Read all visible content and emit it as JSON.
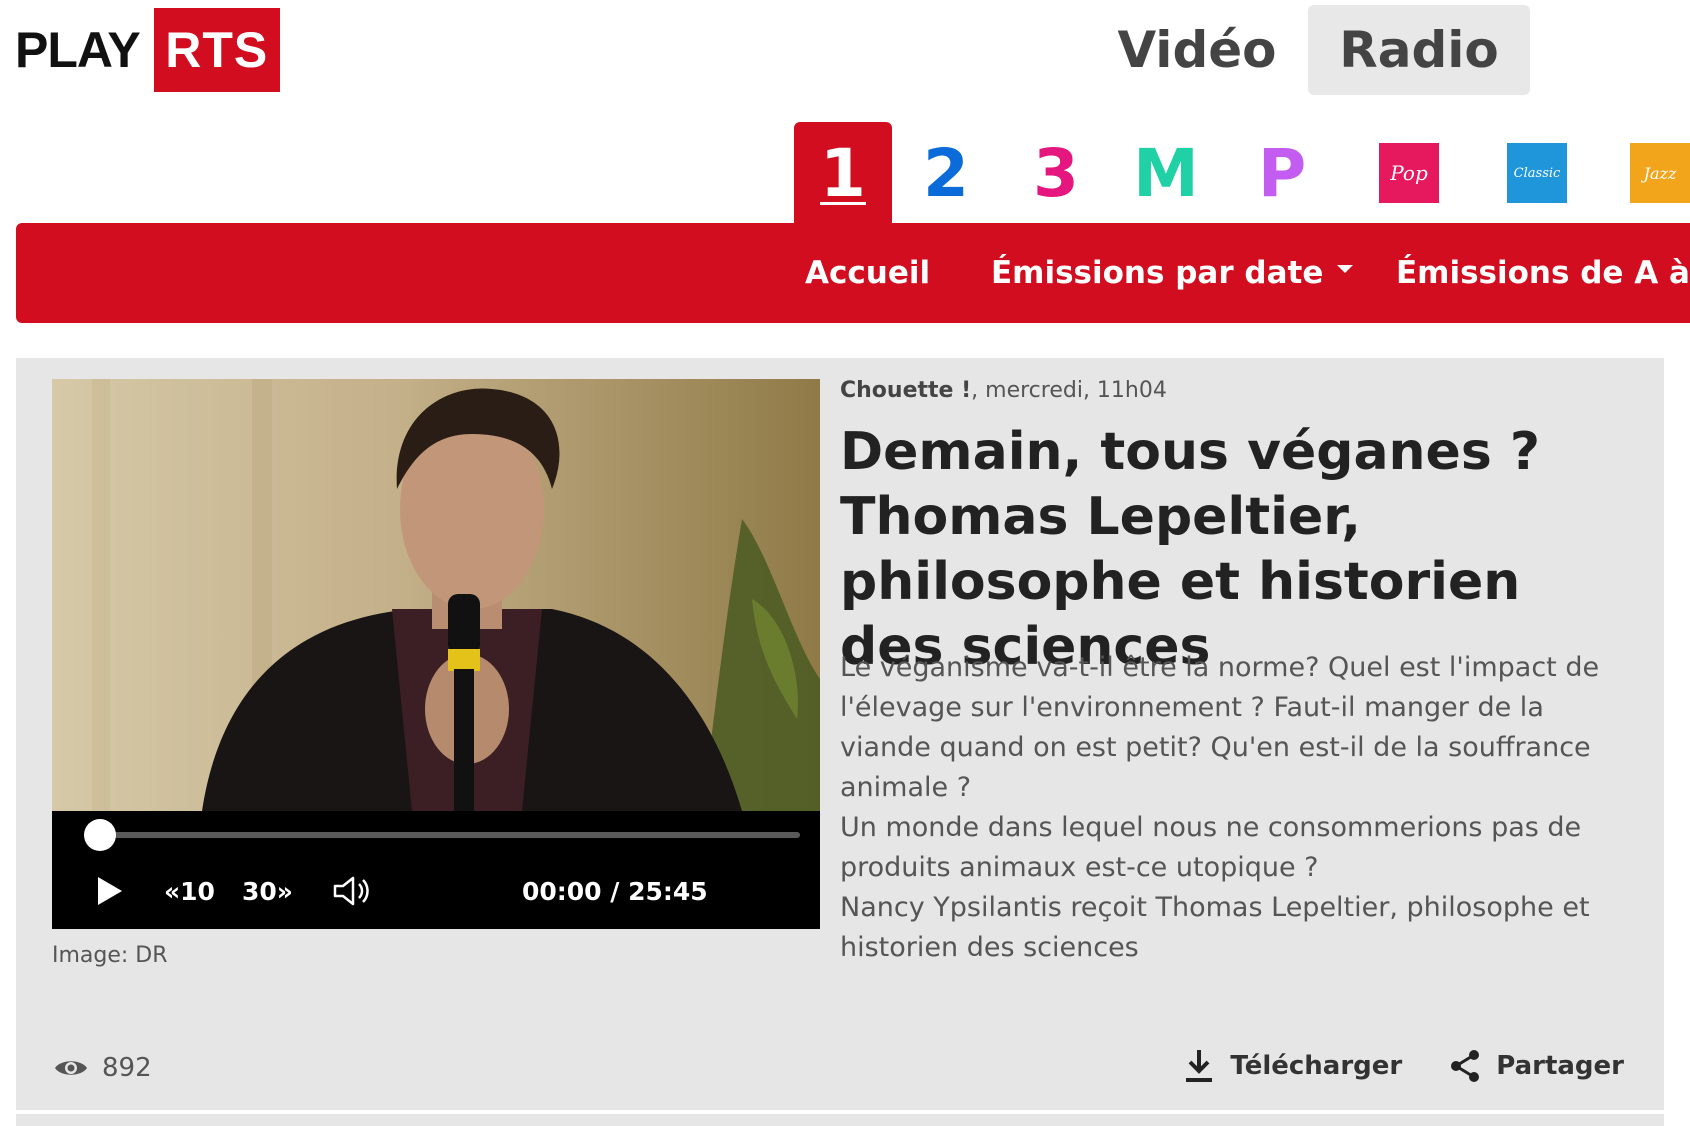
{
  "header": {
    "logo_play": "PLAY",
    "logo_rts": "RTS",
    "switch": [
      {
        "label": "Vidéo",
        "active": false
      },
      {
        "label": "Radio",
        "active": true
      }
    ]
  },
  "channels": {
    "active": "1",
    "items": [
      {
        "label": "1",
        "color": "#ffffff"
      },
      {
        "label": "2",
        "color": "#0a6bd9"
      },
      {
        "label": "3",
        "color": "#e6167f"
      },
      {
        "label": "M",
        "color": "#1fd1a4"
      },
      {
        "label": "P",
        "color": "#c35cf0"
      },
      {
        "label": "Pop",
        "color": "#e6195e"
      },
      {
        "label": "Classic",
        "color": "#1f96d9"
      },
      {
        "label": "Jazz",
        "color": "#f2a51a"
      }
    ]
  },
  "nav": {
    "items": [
      {
        "label": "Accueil"
      },
      {
        "label": "Émissions par date"
      },
      {
        "label": "Émissions de A à Z"
      }
    ],
    "accent": "#d20d1f"
  },
  "episode": {
    "show": "Chouette !",
    "when": ", mercredi, 11h04",
    "title": "Demain, tous véganes ? Thomas Lepeltier, philosophe et historien des sciences",
    "description": [
      "Le véganisme va-t-il être la norme? Quel est l'impact de l'élevage sur l'environnement ? Faut-il manger de la viande quand on est petit? Qu'en est-il de la souffrance animale ?",
      "Un monde dans lequel nous ne consommerions pas de produits animaux est-ce utopique ?",
      "Nancy Ypsilantis reçoit Thomas Lepeltier, philosophe et historien des sciences"
    ],
    "image_credit": "Image: DR",
    "views": "892"
  },
  "player": {
    "back_label": "10",
    "fwd_label": "30",
    "current_time": "00:00",
    "duration": "25:45",
    "progress": 0
  },
  "actions": {
    "download": "Télécharger",
    "share": "Partager"
  }
}
